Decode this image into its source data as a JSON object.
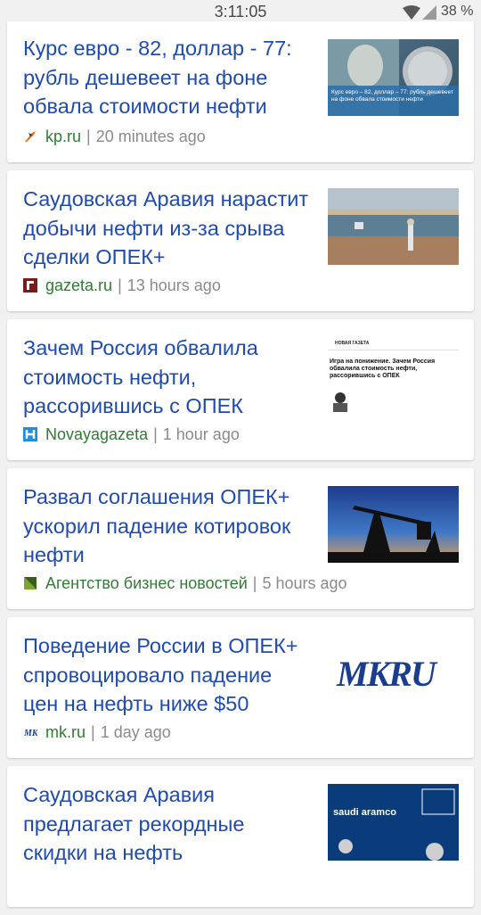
{
  "status_bar": {
    "time": "3:11:05",
    "battery": "38 %"
  },
  "articles": [
    {
      "headline": "Курс евро - 82, доллар - 77: рубль дешевеет на фоне обвала стоимости нефти",
      "source": "kp.ru",
      "time": "20 minutes ago",
      "thumb_text": "Курс евро – 82, доллар – 77: рубль дешевеет на фоне обвала стоимости нефти"
    },
    {
      "headline": "Саудовская Аравия нарастит добычи нефти из-за срыва сделки ОПЕК+",
      "source": "gazeta.ru",
      "time": "13 hours ago"
    },
    {
      "headline": "Зачем Россия обвалила стоимость нефти, рассорившись с ОПЕК",
      "source": "Novayagazeta",
      "time": "1 hour ago",
      "thumb_brand": "НОВАЯ ГАЗЕТА",
      "thumb_text": "Игра на понижение. Зачем Россия обвалила стоимость нефти, рассорившись с ОПЕК"
    },
    {
      "headline": "Развал соглашения ОПЕК+ ускорил падение котировок нефти",
      "source": "Агентство бизнес новостей",
      "time": "5 hours ago"
    },
    {
      "headline": "Поведение России в ОПЕК+ спровоцировало падение цен на нефть ниже $50",
      "source": "mk.ru",
      "time": "1 day ago",
      "thumb_logo": "MKRU"
    },
    {
      "headline": "Саудовская Аравия предлагает рекордные скидки на нефть",
      "thumb_brand": "saudi aramco"
    }
  ]
}
